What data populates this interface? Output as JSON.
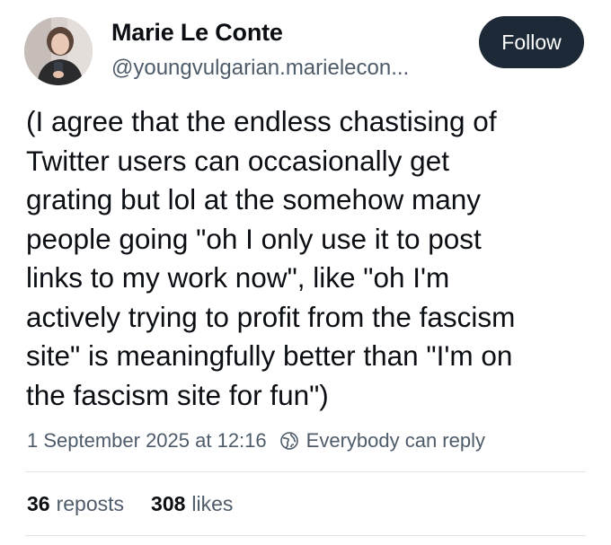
{
  "author": {
    "display_name": "Marie Le Conte",
    "handle": "@youngvulgarian.marielecon..."
  },
  "follow_button": {
    "label": "Follow"
  },
  "post": {
    "text_lines": [
      "(I agree that the endless chastising of",
      "Twitter users can occasionally get",
      "grating but lol at the somehow many",
      "people going \"oh I only use it to post",
      "links to my work now\", like \"oh I'm",
      "actively trying to profit from the fascism",
      "site\" is meaningfully better than \"I'm on",
      "the fascism site for fun\")"
    ],
    "timestamp": "1 September 2025 at 12:16",
    "reply_setting": "Everybody can reply"
  },
  "stats": {
    "reposts": {
      "count": "36",
      "label": "reposts"
    },
    "likes": {
      "count": "308",
      "label": "likes"
    }
  },
  "icons": {
    "avatar": "profile-photo",
    "reply_setting": "globe-icon"
  },
  "colors": {
    "text_primary": "#0b0f14",
    "text_secondary": "#4e5b69",
    "follow_button_bg": "#1e2937",
    "divider": "#dfe3e8"
  }
}
